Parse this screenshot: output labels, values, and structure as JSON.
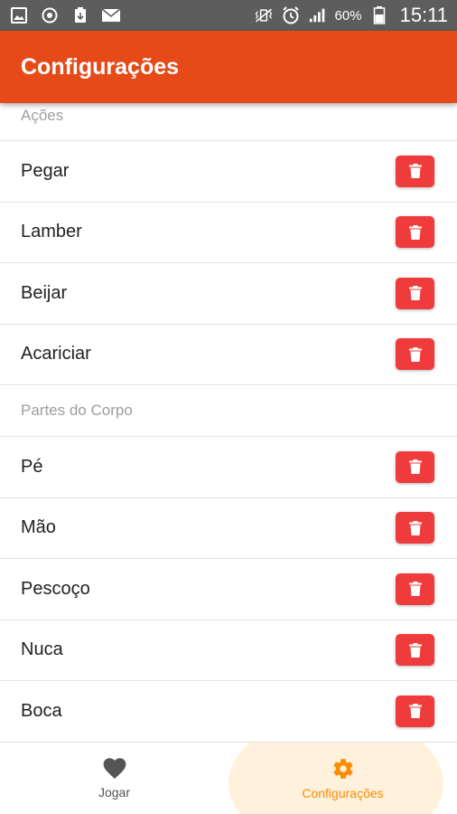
{
  "status_bar": {
    "battery": "60%",
    "time": "15:11",
    "icons": [
      "image-icon",
      "sync-icon",
      "download-icon",
      "mail-icon",
      "vibrate-icon",
      "alarm-icon",
      "signal-icon",
      "battery-icon"
    ]
  },
  "app_bar": {
    "title": "Configurações",
    "color": "#e64a19"
  },
  "sections": [
    {
      "header": "Ações",
      "items": [
        {
          "label": "Pegar"
        },
        {
          "label": "Lamber"
        },
        {
          "label": "Beijar"
        },
        {
          "label": "Acariciar"
        }
      ]
    },
    {
      "header": "Partes do Corpo",
      "items": [
        {
          "label": "Pé"
        },
        {
          "label": "Mão"
        },
        {
          "label": "Pescoço"
        },
        {
          "label": "Nuca"
        },
        {
          "label": "Boca"
        }
      ]
    }
  ],
  "delete_button": {
    "icon": "trash-icon",
    "color": "#ef3b3b"
  },
  "bottom_nav": {
    "tabs": [
      {
        "label": "Jogar",
        "icon": "heart-icon",
        "active": false
      },
      {
        "label": "Configurações",
        "icon": "gear-icon",
        "active": true
      }
    ],
    "active_color": "#fb8c00"
  }
}
